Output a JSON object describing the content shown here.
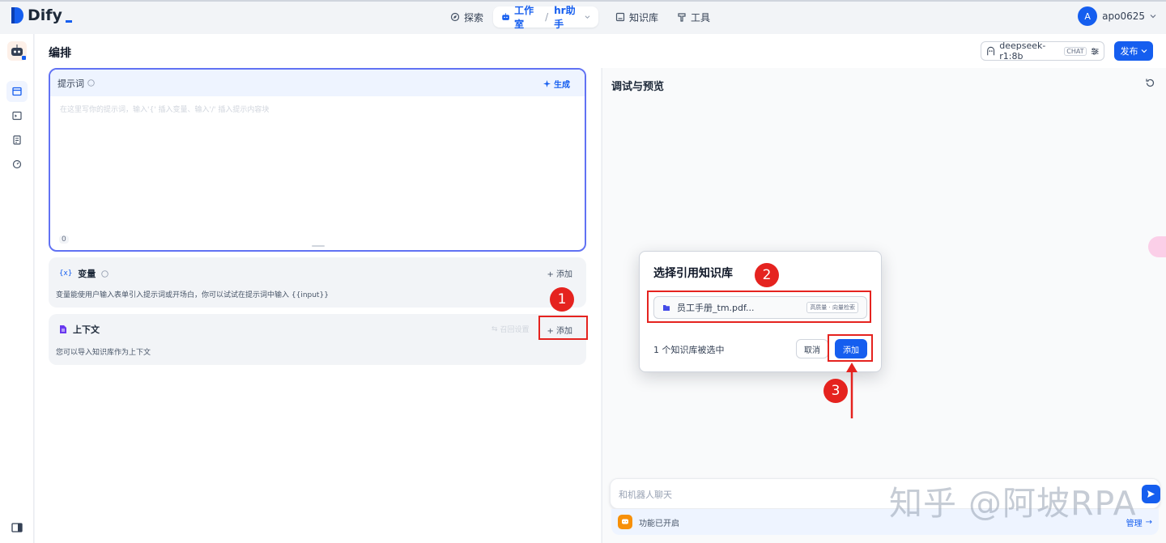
{
  "app": {
    "logo_text": "Dify"
  },
  "nav": {
    "explore": "探索",
    "studio": "工作室",
    "app_name": "hr助手",
    "knowledge": "知识库",
    "tools": "工具"
  },
  "user": {
    "initial": "A",
    "name": "apo0625"
  },
  "page": {
    "title": "编排"
  },
  "model": {
    "name": "deepseek-r1:8b",
    "mode_badge": "CHAT"
  },
  "publish_label": "发布",
  "prompt": {
    "title": "提示词",
    "generate_label": "生成",
    "placeholder": "在这里写你的提示词，输入'{' 插入变量、输入'/' 插入提示内容块",
    "char_count": "0"
  },
  "variables": {
    "icon_text": "{x}",
    "title": "变量",
    "add_label": "添加",
    "description": "变量能使用户输入表单引入提示词或开场白，你可以试试在提示词中输入 {{input}}"
  },
  "context": {
    "title": "上下文",
    "recall_label": "召回设置",
    "add_label": "添加",
    "description": "您可以导入知识库作为上下文"
  },
  "debug": {
    "title": "调试与预览",
    "chat_placeholder": "和机器人聊天",
    "features_label": "功能已开启",
    "manage_label": "管理"
  },
  "modal": {
    "title": "选择引用知识库",
    "kb_name": "员工手册_tm.pdf...",
    "kb_tag": "高质量 · 向量检索",
    "selected_text": "1 个知识库被选中",
    "cancel_label": "取消",
    "add_label": "添加"
  },
  "annotations": {
    "step1": "1",
    "step2": "2",
    "step3": "3",
    "color": "#e5231f"
  },
  "watermark": "知乎 @阿坡RPA",
  "colors": {
    "primary": "#155eef",
    "accent_border": "#6172f3",
    "annotation_red": "#e5231f"
  }
}
